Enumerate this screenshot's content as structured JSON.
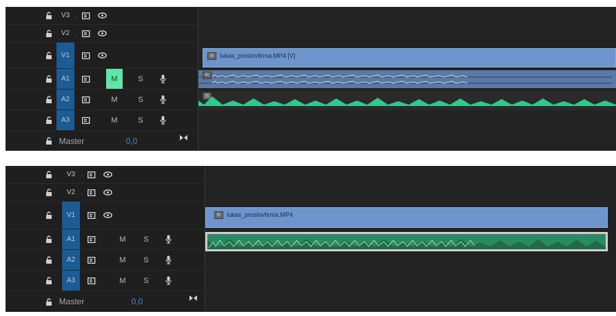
{
  "panels": [
    {
      "id": "top",
      "tracks": [
        {
          "name": "V3",
          "kind": "video",
          "targeted": false
        },
        {
          "name": "V2",
          "kind": "video",
          "targeted": false
        },
        {
          "name": "V1",
          "kind": "video",
          "targeted": true
        },
        {
          "name": "A1",
          "kind": "audio",
          "targeted": true,
          "mute_active": true
        },
        {
          "name": "A2",
          "kind": "audio",
          "targeted": true,
          "mute_active": false
        },
        {
          "name": "A3",
          "kind": "audio",
          "targeted": true,
          "mute_active": false
        }
      ],
      "mute_label": "M",
      "solo_label": "S",
      "master_label": "Master",
      "master_value": "0,0",
      "video_clip": "lukas_proslovfirma.MP4 [V]",
      "fx_badge": "fx"
    },
    {
      "id": "bottom",
      "tracks": [
        {
          "name": "V3",
          "kind": "video",
          "targeted": false
        },
        {
          "name": "V2",
          "kind": "video",
          "targeted": false
        },
        {
          "name": "V1",
          "kind": "video",
          "targeted": true
        },
        {
          "name": "A1",
          "kind": "audio",
          "targeted": true,
          "mute_active": false
        },
        {
          "name": "A2",
          "kind": "audio",
          "targeted": true,
          "mute_active": false
        },
        {
          "name": "A3",
          "kind": "audio",
          "targeted": true,
          "mute_active": false
        }
      ],
      "mute_label": "M",
      "solo_label": "S",
      "master_label": "Master",
      "master_value": "0,0",
      "video_clip": "lukas_proslovfirma.MP4",
      "fx_badge": "fx"
    }
  ],
  "colors": {
    "targeted": "#1b5c94",
    "mute_on": "#5fe6a6",
    "video_clip": "#6d94cb",
    "audio_waveform_blue": "#5a7aa8",
    "audio_waveform_green": "#2fc98b",
    "master_value": "#3c8ed6"
  },
  "icons": [
    "lock-icon",
    "sync-lock-icon",
    "eye-icon",
    "mic-icon",
    "bowtie-icon"
  ]
}
